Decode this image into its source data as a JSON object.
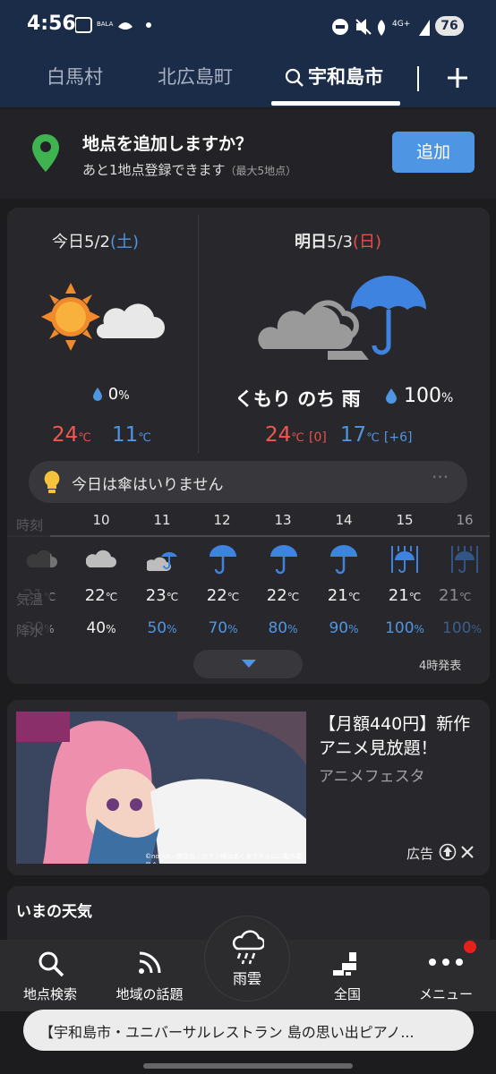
{
  "status_bar": {
    "time": "4:56",
    "battery": "76",
    "network": "4G+",
    "app_badge": "BALA"
  },
  "tabs": [
    {
      "label": "白馬村"
    },
    {
      "label": "北広島町"
    },
    {
      "label": "宇和島市"
    }
  ],
  "banner": {
    "title": "地点を追加しますか？",
    "subtitle": "あと1地点登録できます",
    "note": "（最大5地点）",
    "button": "追加"
  },
  "today": {
    "label": "今日5/2",
    "weekday": "(土)",
    "rain_pct": "0",
    "rain_unit": "%",
    "high": "24",
    "low": "11",
    "unit": "℃"
  },
  "tomorrow": {
    "label": "明日",
    "date": "5/3",
    "weekday": "(日)",
    "weather": "くもり のち 雨",
    "rain_pct": "100",
    "rain_unit": "%",
    "high": "24",
    "high_diff": "[0]",
    "low": "17",
    "low_diff": "[+6]",
    "unit": "℃"
  },
  "umbrella_tip": "今日は傘はいりません",
  "hourly": {
    "row_labels": {
      "hour": "時刻",
      "temp": "気温",
      "rain": "降水"
    },
    "unit_temp": "℃",
    "unit_rain": "%",
    "hours": [
      {
        "hour": "",
        "icon": "cloud-icon",
        "temp": "21",
        "rain": "30"
      },
      {
        "hour": "10",
        "icon": "cloud-icon",
        "temp": "22",
        "rain": "40"
      },
      {
        "hour": "11",
        "icon": "cloud-umbrella-icon",
        "temp": "23",
        "rain": "50"
      },
      {
        "hour": "12",
        "icon": "umbrella-icon",
        "temp": "22",
        "rain": "70"
      },
      {
        "hour": "13",
        "icon": "umbrella-icon",
        "temp": "22",
        "rain": "80"
      },
      {
        "hour": "14",
        "icon": "umbrella-icon",
        "temp": "21",
        "rain": "90"
      },
      {
        "hour": "15",
        "icon": "heavy-rain-umbrella-icon",
        "temp": "21",
        "rain": "100"
      },
      {
        "hour": "16",
        "icon": "heavy-rain-umbrella-icon",
        "temp": "21",
        "rain": "100"
      }
    ],
    "issued": "4時発表"
  },
  "ad": {
    "title": "【月額440円】新作アニメ見放題！",
    "source": "アニメフェスタ",
    "label": "広告",
    "copyright": "©nonco・講談社／カナン様はあくまでチョロい製作委員会"
  },
  "now": {
    "title": "いまの天気"
  },
  "nav": {
    "search": "地点検索",
    "topics": "地域の話題",
    "radar": "雨雲",
    "national": "全国",
    "menu": "メニュー"
  },
  "toast": "【宇和島市・ユニバーサルレストラン 島の思い出ピアノ..."
}
